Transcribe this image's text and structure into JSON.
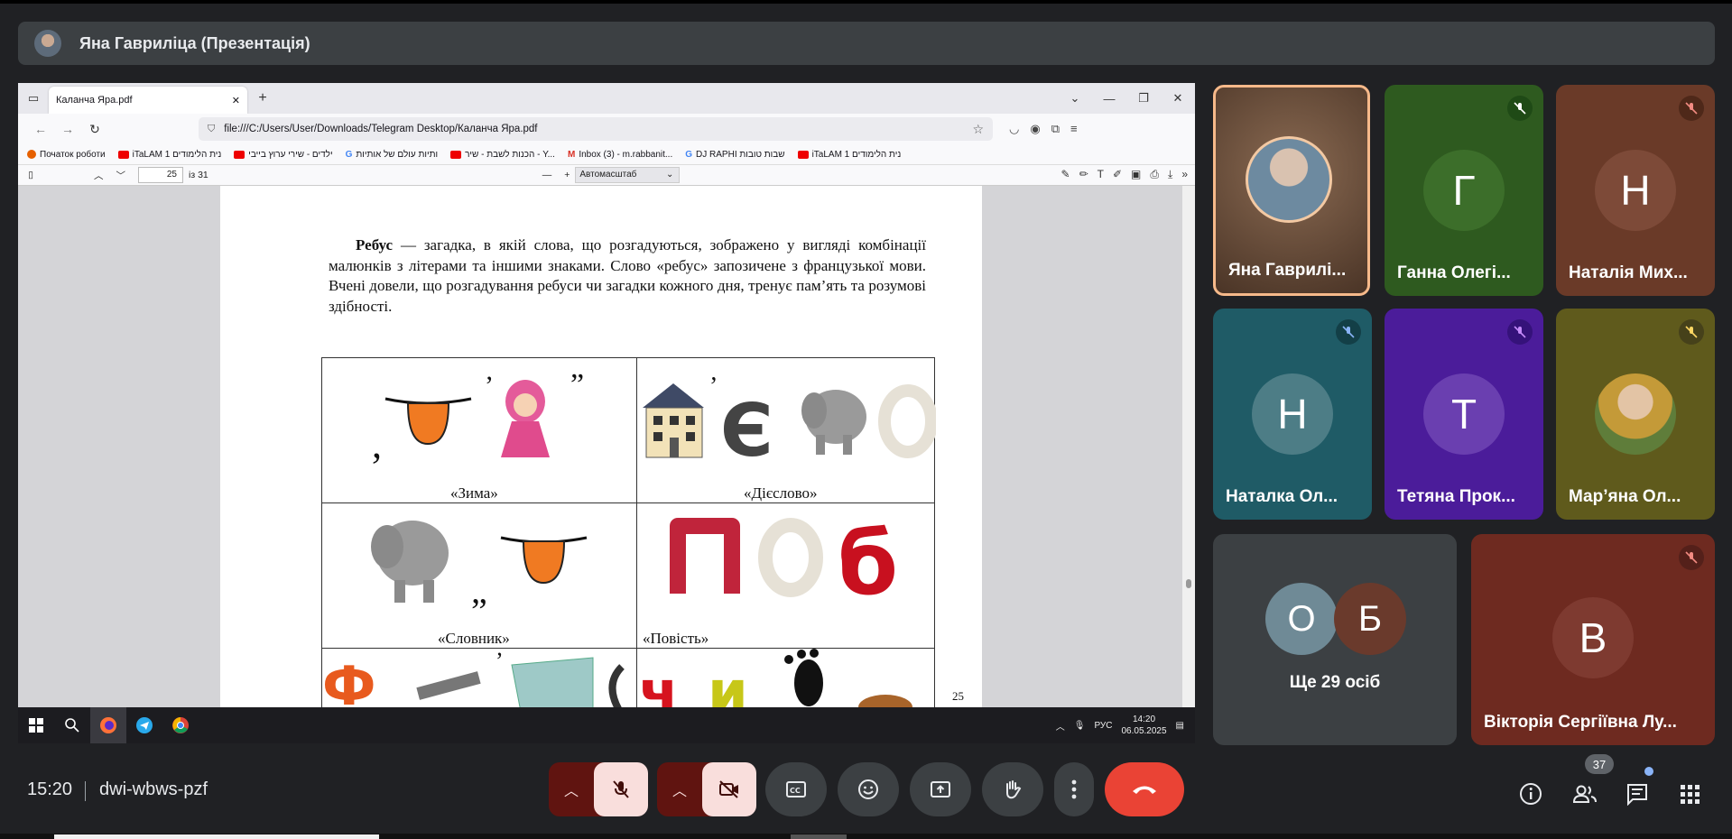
{
  "presenter_bar": {
    "title": "Яна Гавриліца (Презентація)"
  },
  "browser": {
    "tab_title": "Каланча Яра.pdf",
    "new_tab": "+",
    "url": "file:///C:/Users/User/Downloads/Telegram Desktop/Каланча Яра.pdf",
    "bookmarks": [
      "Початок роботи",
      "iTaLAM 1 נית הלימודים",
      "ילדים - שירי ערוץ בייבי",
      "ותיות עולם של אותיות",
      "הכנות לשבת - שיר - Y...",
      "Inbox (3) - m.rabbanit...",
      "DJ RAPHI שבות טובות",
      "iTaLAM 1 נית הלימודים"
    ]
  },
  "pdf": {
    "page_current": "25",
    "page_of": "із 31",
    "zoom": "Автомасштаб",
    "para_bold": "Ребус",
    "para_text": " — загадка, в якій слова, що розгадуються, зображено у вигляді комбінації малюнків з літерами та іншими знаками. Слово «ребус» запозичене з французької мови. Вчені довели, що розгадування ребуси чи загадки кожного дня, тренує пам’ять та розумові здібності.",
    "captions": [
      "«Зима»",
      "«Дієслово»",
      "«Словник»",
      "«Повість»"
    ],
    "page_number": "25"
  },
  "taskbar": {
    "lang": "РУС",
    "time": "14:20",
    "date": "06.05.2025"
  },
  "participants": [
    {
      "name": "Яна Гаврилі...",
      "initial": "",
      "color": "#6b4a34"
    },
    {
      "name": "Ганна Олегі...",
      "initial": "Г",
      "color": "#2e5a1f"
    },
    {
      "name": "Наталія Мих...",
      "initial": "Н",
      "color": "#6a3a28"
    },
    {
      "name": "Наталка Ол...",
      "initial": "Н",
      "color": "#1f5b66"
    },
    {
      "name": "Тетяна Прок...",
      "initial": "Т",
      "color": "#4b1c9a"
    },
    {
      "name": "Мар’яна Ол...",
      "initial": "",
      "color": "#5f5a1c"
    }
  ],
  "others": {
    "label": "Ще 29 осіб",
    "initials": [
      "О",
      "Б"
    ]
  },
  "big_tile": {
    "name": "Вікторія Сергіївна Лу...",
    "initial": "В",
    "color": "#6e2a20"
  },
  "bottom": {
    "time": "15:20",
    "meeting_code": "dwi-wbws-pzf",
    "people_count": "37"
  },
  "colors": {
    "end_call": "#ea4335",
    "muted_bg": "#f9dedc",
    "muted_fg": "#410e0b",
    "ctrl_bg": "#3c4043",
    "arrow_bg": "#601410"
  }
}
